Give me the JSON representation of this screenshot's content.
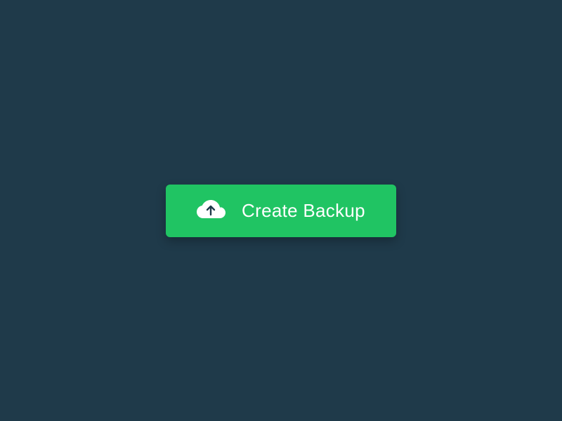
{
  "button": {
    "label": "Create Backup"
  }
}
